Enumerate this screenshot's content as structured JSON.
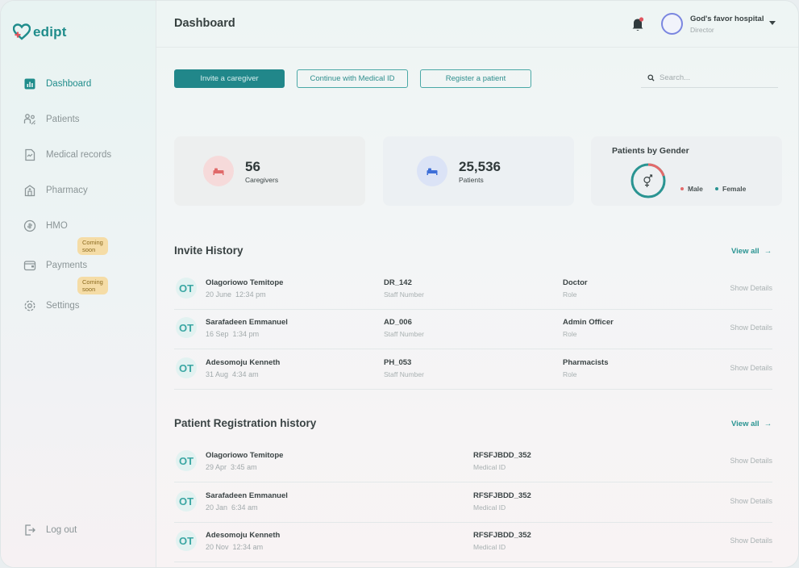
{
  "app": {
    "logo_text": "edipt",
    "brand_color": "#1f8c8b"
  },
  "sidebar": {
    "items": [
      {
        "label": "Dashboard",
        "icon": "chart-icon",
        "active": true
      },
      {
        "label": "Patients",
        "icon": "people-icon"
      },
      {
        "label": "Medical records",
        "icon": "document-icon"
      },
      {
        "label": "Pharmacy",
        "icon": "pharmacy-icon"
      },
      {
        "label": "HMO",
        "icon": "hmo-icon",
        "badge": "Coming soon"
      },
      {
        "label": "Payments",
        "icon": "wallet-icon",
        "badge": "Coming soon"
      },
      {
        "label": "Settings",
        "icon": "gear-icon"
      }
    ],
    "logout_label": "Log out"
  },
  "header": {
    "title": "Dashboard",
    "user_name": "God's favor hospital",
    "user_role": "Director"
  },
  "actions": {
    "invite": "Invite a caregiver",
    "medical_id": "Continue with Medical ID",
    "register": "Register a patient",
    "search_placeholder": "Search..."
  },
  "stats": {
    "caregivers": {
      "value": "56",
      "label": "Caregivers"
    },
    "patients": {
      "value": "25,536",
      "label": "Patients"
    },
    "gender": {
      "title": "Patients by Gender",
      "male": "Male",
      "female": "Female",
      "male_color": "#e46a6a",
      "female_color": "#2a9492"
    }
  },
  "invite_history": {
    "title": "Invite History",
    "view_all": "View all",
    "rows": [
      {
        "initials": "OT",
        "name": "Olagoriowo Temitope",
        "date": "20 June",
        "time": "12:34 pm",
        "code": "DR_142",
        "code_label": "Staff Number",
        "role": "Doctor",
        "role_label": "Role",
        "details": "Show Details"
      },
      {
        "initials": "OT",
        "name": "Sarafadeen Emmanuel",
        "date": "16 Sep",
        "time": "1:34 pm",
        "code": "AD_006",
        "code_label": "Staff Number",
        "role": "Admin Officer",
        "role_label": "Role",
        "details": "Show Details"
      },
      {
        "initials": "OT",
        "name": "Adesomoju Kenneth",
        "date": "31 Aug",
        "time": "4:34 am",
        "code": "PH_053",
        "code_label": "Staff Number",
        "role": "Pharmacists",
        "role_label": "Role",
        "details": "Show Details"
      }
    ]
  },
  "registration_history": {
    "title": "Patient Registration history",
    "view_all": "View all",
    "rows": [
      {
        "initials": "OT",
        "name": "Olagoriowo Temitope",
        "date": "29 Apr",
        "time": "3:45 am",
        "code": "RFSFJBDD_352",
        "code_label": "Medical ID",
        "details": "Show Details"
      },
      {
        "initials": "OT",
        "name": "Sarafadeen Emmanuel",
        "date": "20 Jan",
        "time": "6:34 am",
        "code": "RFSFJBDD_352",
        "code_label": "Medical ID",
        "details": "Show Details"
      },
      {
        "initials": "OT",
        "name": "Adesomoju Kenneth",
        "date": "20 Nov",
        "time": "12:34 am",
        "code": "RFSFJBDD_352",
        "code_label": "Medical ID",
        "details": "Show Details"
      }
    ]
  }
}
